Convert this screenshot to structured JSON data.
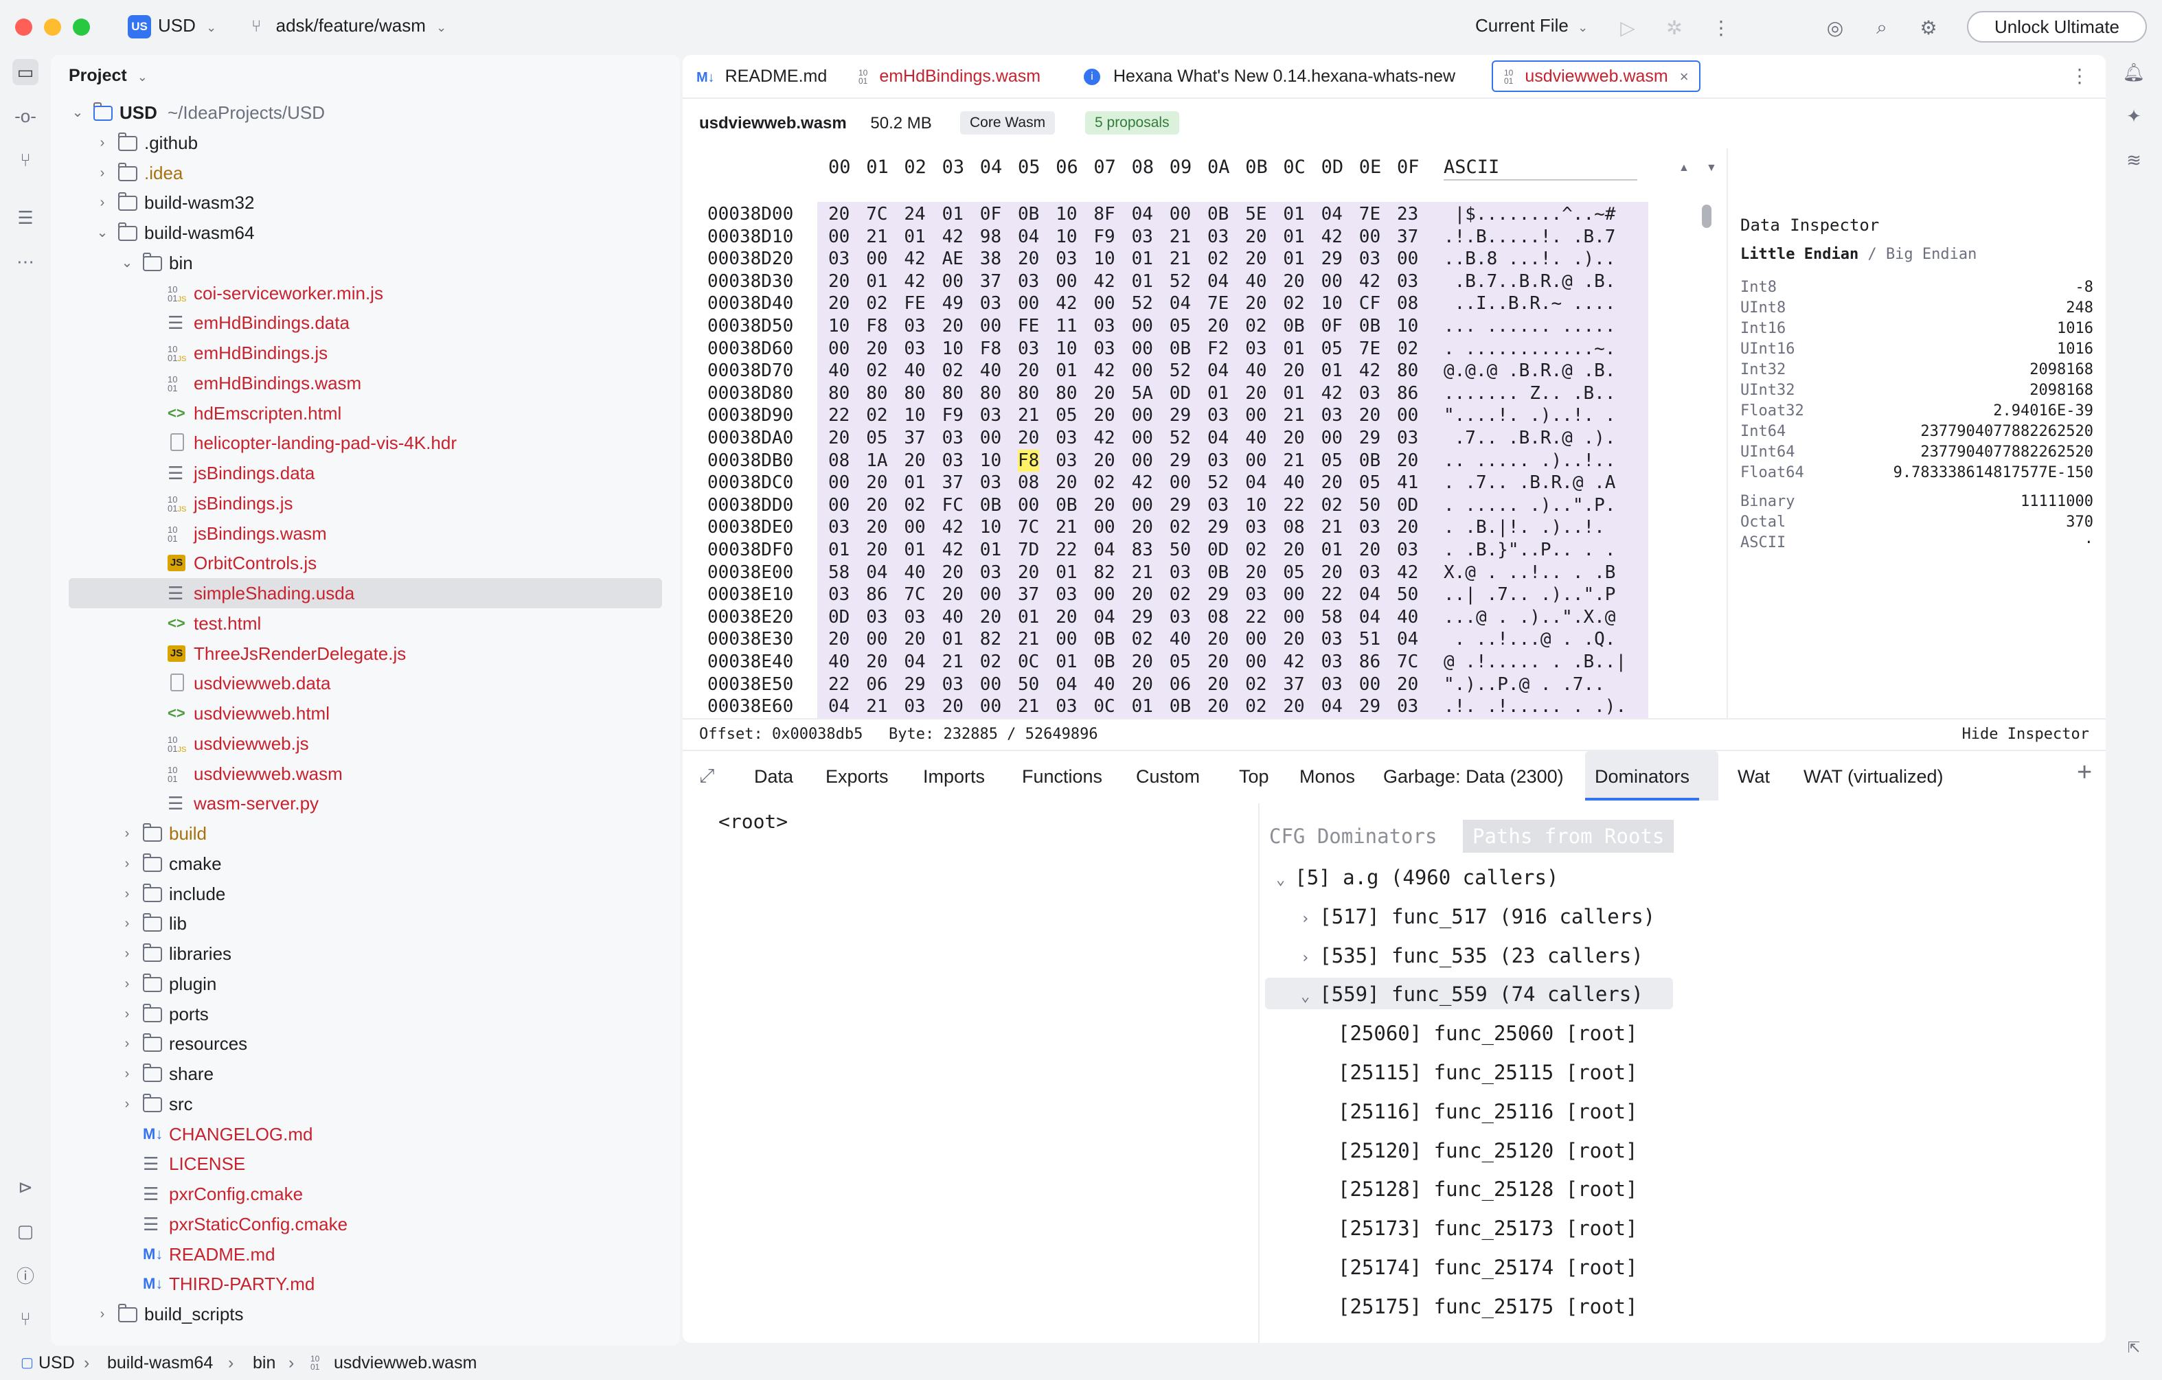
{
  "titlebar": {
    "project_badge": "US",
    "project_name": "USD",
    "branch": "adsk/feature/wasm",
    "run_config": "Current File",
    "unlock_label": "Unlock Ultimate"
  },
  "project_panel": {
    "header": "Project",
    "tree": [
      {
        "label": "USD",
        "suffix": "~/IdeaProjects/USD",
        "depth": 0,
        "chev": "down",
        "icon": "module",
        "color": "dark",
        "bold": true
      },
      {
        "label": ".github",
        "depth": 1,
        "chev": "right",
        "icon": "folder-git",
        "color": "dark"
      },
      {
        "label": ".idea",
        "depth": 1,
        "chev": "right",
        "icon": "folder",
        "color": "brown"
      },
      {
        "label": "build-wasm32",
        "depth": 1,
        "chev": "right",
        "icon": "folder",
        "color": "dark"
      },
      {
        "label": "build-wasm64",
        "depth": 1,
        "chev": "down",
        "icon": "folder",
        "color": "dark"
      },
      {
        "label": "bin",
        "depth": 2,
        "chev": "down",
        "icon": "folder",
        "color": "dark"
      },
      {
        "label": "coi-serviceworker.min.js",
        "depth": 3,
        "icon": "binjs",
        "color": "red"
      },
      {
        "label": "emHdBindings.data",
        "depth": 3,
        "icon": "lines",
        "color": "red"
      },
      {
        "label": "emHdBindings.js",
        "depth": 3,
        "icon": "binjs",
        "color": "red"
      },
      {
        "label": "emHdBindings.wasm",
        "depth": 3,
        "icon": "bin",
        "color": "red"
      },
      {
        "label": "hdEmscripten.html",
        "depth": 3,
        "icon": "html",
        "color": "red"
      },
      {
        "label": "helicopter-landing-pad-vis-4K.hdr",
        "depth": 3,
        "icon": "file",
        "color": "red"
      },
      {
        "label": "jsBindings.data",
        "depth": 3,
        "icon": "lines",
        "color": "red"
      },
      {
        "label": "jsBindings.js",
        "depth": 3,
        "icon": "binjs",
        "color": "red"
      },
      {
        "label": "jsBindings.wasm",
        "depth": 3,
        "icon": "bin",
        "color": "red"
      },
      {
        "label": "OrbitControls.js",
        "depth": 3,
        "icon": "js",
        "color": "red"
      },
      {
        "label": "simpleShading.usda",
        "depth": 3,
        "icon": "lines",
        "color": "red",
        "selected": true
      },
      {
        "label": "test.html",
        "depth": 3,
        "icon": "html",
        "color": "red"
      },
      {
        "label": "ThreeJsRenderDelegate.js",
        "depth": 3,
        "icon": "js",
        "color": "red"
      },
      {
        "label": "usdviewweb.data",
        "depth": 3,
        "icon": "file",
        "color": "red"
      },
      {
        "label": "usdviewweb.html",
        "depth": 3,
        "icon": "html",
        "color": "red"
      },
      {
        "label": "usdviewweb.js",
        "depth": 3,
        "icon": "binjs",
        "color": "red"
      },
      {
        "label": "usdviewweb.wasm",
        "depth": 3,
        "icon": "bin",
        "color": "red"
      },
      {
        "label": "wasm-server.py",
        "depth": 3,
        "icon": "lines",
        "color": "red"
      },
      {
        "label": "build",
        "depth": 2,
        "chev": "right",
        "icon": "folder",
        "color": "brown"
      },
      {
        "label": "cmake",
        "depth": 2,
        "chev": "right",
        "icon": "folder",
        "color": "dark"
      },
      {
        "label": "include",
        "depth": 2,
        "chev": "right",
        "icon": "folder",
        "color": "dark"
      },
      {
        "label": "lib",
        "depth": 2,
        "chev": "right",
        "icon": "folder",
        "color": "dark"
      },
      {
        "label": "libraries",
        "depth": 2,
        "chev": "right",
        "icon": "folder",
        "color": "dark"
      },
      {
        "label": "plugin",
        "depth": 2,
        "chev": "right",
        "icon": "folder",
        "color": "dark"
      },
      {
        "label": "ports",
        "depth": 2,
        "chev": "right",
        "icon": "folder",
        "color": "dark"
      },
      {
        "label": "resources",
        "depth": 2,
        "chev": "right",
        "icon": "folder",
        "color": "dark"
      },
      {
        "label": "share",
        "depth": 2,
        "chev": "right",
        "icon": "folder",
        "color": "dark"
      },
      {
        "label": "src",
        "depth": 2,
        "chev": "right",
        "icon": "folder",
        "color": "dark"
      },
      {
        "label": "CHANGELOG.md",
        "depth": 1.5,
        "icon": "md",
        "color": "red"
      },
      {
        "label": "LICENSE",
        "depth": 1.5,
        "icon": "lines",
        "color": "red"
      },
      {
        "label": "pxrConfig.cmake",
        "depth": 1.5,
        "icon": "lines",
        "color": "red"
      },
      {
        "label": "pxrStaticConfig.cmake",
        "depth": 1.5,
        "icon": "lines",
        "color": "red"
      },
      {
        "label": "README.md",
        "depth": 1.5,
        "icon": "md",
        "color": "red"
      },
      {
        "label": "THIRD-PARTY.md",
        "depth": 1.5,
        "icon": "md",
        "color": "red"
      },
      {
        "label": "build_scripts",
        "depth": 1,
        "chev": "right",
        "icon": "folder",
        "color": "dark"
      }
    ]
  },
  "editor": {
    "tabs": [
      {
        "icon": "M↓",
        "label": "README.md",
        "color": "dark"
      },
      {
        "icon": "10\n01",
        "label": "emHdBindings.wasm",
        "color": "red"
      },
      {
        "icon": "i",
        "label": "Hexana What's New 0.14.hexana-whats-new",
        "color": "dark"
      },
      {
        "icon": "10\n01",
        "label": "usdviewweb.wasm",
        "color": "red",
        "active": true
      }
    ],
    "file_name": "usdviewweb.wasm",
    "file_size": "50.2 MB",
    "badge_format": "Core Wasm",
    "badge_proposals": "5 proposals",
    "hex_header_cols": [
      "00",
      "01",
      "02",
      "03",
      "04",
      "05",
      "06",
      "07",
      "08",
      "09",
      "0A",
      "0B",
      "0C",
      "0D",
      "0E",
      "0F"
    ],
    "ascii_header": "ASCII",
    "hex_rows": [
      {
        "off": "00038D00",
        "bytes": "20 7C 24 01 0F 0B 10 8F 04 00 0B 5E 01 04 7E 23",
        "ascii": " |$........^..~#"
      },
      {
        "off": "00038D10",
        "bytes": "00 21 01 42 98 04 10 F9 03 21 03 20 01 42 00 37",
        "ascii": ".!.B.....!. .B.7"
      },
      {
        "off": "00038D20",
        "bytes": "03 00 42 AE 38 20 03 10 01 21 02 20 01 29 03 00",
        "ascii": "..B.8 ...!. .).."
      },
      {
        "off": "00038D30",
        "bytes": "20 01 42 00 37 03 00 42 01 52 04 40 20 00 42 03",
        "ascii": " .B.7..B.R.@ .B."
      },
      {
        "off": "00038D40",
        "bytes": "20 02 FE 49 03 00 42 00 52 04 7E 20 02 10 CF 08",
        "ascii": " ..I..B.R.~ ...."
      },
      {
        "off": "00038D50",
        "bytes": "10 F8 03 20 00 FE 11 03 00 05 20 02 0B 0F 0B 10",
        "ascii": "... ...... ....."
      },
      {
        "off": "00038D60",
        "bytes": "00 20 03 10 F8 03 10 03 00 0B F2 03 01 05 7E 02",
        "ascii": ". ............~."
      },
      {
        "off": "00038D70",
        "bytes": "40 02 40 02 40 20 01 42 00 52 04 40 20 01 42 80",
        "ascii": "@.@.@ .B.R.@ .B."
      },
      {
        "off": "00038D80",
        "bytes": "80 80 80 80 80 80 80 20 5A 0D 01 20 01 42 03 86",
        "ascii": "....... Z.. .B.."
      },
      {
        "off": "00038D90",
        "bytes": "22 02 10 F9 03 21 05 20 00 29 03 00 21 03 20 00",
        "ascii": "\"....!. .)..!. ."
      },
      {
        "off": "00038DA0",
        "bytes": "20 05 37 03 00 20 03 42 00 52 04 40 20 00 29 03",
        "ascii": " .7.. .B.R.@ .)."
      },
      {
        "off": "00038DB0",
        "bytes": "08 1A 20 03 10 F8 03 20 00 29 03 00 21 05 0B 20",
        "ascii": ".. ..... .)..!.. "
      },
      {
        "off": "00038DC0",
        "bytes": "00 20 01 37 03 08 20 02 42 00 52 04 40 20 05 41",
        "ascii": ". .7.. .B.R.@ .A"
      },
      {
        "off": "00038DD0",
        "bytes": "00 20 02 FC 0B 00 0B 20 00 29 03 10 22 02 50 0D",
        "ascii": ". ..... .)..\".P."
      },
      {
        "off": "00038DE0",
        "bytes": "03 20 00 42 10 7C 21 00 20 02 29 03 08 21 03 20",
        "ascii": ". .B.|!. .)..!. "
      },
      {
        "off": "00038DF0",
        "bytes": "01 20 01 42 01 7D 22 04 83 50 0D 02 20 01 20 03",
        "ascii": ". .B.}\"..P.. . ."
      },
      {
        "off": "00038E00",
        "bytes": "58 04 40 20 03 20 01 82 21 03 0B 20 05 20 03 42",
        "ascii": "X.@ . ..!.. . .B"
      },
      {
        "off": "00038E10",
        "bytes": "03 86 7C 20 00 37 03 00 20 02 29 03 00 22 04 50",
        "ascii": "..| .7.. .)..\".P"
      },
      {
        "off": "00038E20",
        "bytes": "0D 03 03 40 20 01 20 04 29 03 08 22 00 58 04 40",
        "ascii": "...@ . .)..\".X.@"
      },
      {
        "off": "00038E30",
        "bytes": "20 00 20 01 82 21 00 0B 02 40 20 00 20 03 51 04",
        "ascii": " . ..!...@ . .Q."
      },
      {
        "off": "00038E40",
        "bytes": "40 20 04 21 02 0C 01 0B 20 05 20 00 42 03 86 7C",
        "ascii": "@ .!..... . .B..|"
      },
      {
        "off": "00038E50",
        "bytes": "22 06 29 03 00 50 04 40 20 06 20 02 37 03 00 20",
        "ascii": "\".)..P.@ . .7.. "
      },
      {
        "off": "00038E60",
        "bytes": "04 21 03 20 00 21 03 0C 01 0B 20 02 20 04 29 03",
        "ascii": ".!. .!..... . .)."
      }
    ],
    "highlight": {
      "row": 11,
      "col": 5
    },
    "inspector": {
      "title": "Data Inspector",
      "endian_active": "Little Endian",
      "endian_sep": "/",
      "endian_other": "Big Endian",
      "rows": [
        {
          "k": "Int8",
          "v": "-8"
        },
        {
          "k": "UInt8",
          "v": "248"
        },
        {
          "k": "Int16",
          "v": "1016"
        },
        {
          "k": "UInt16",
          "v": "1016"
        },
        {
          "k": "Int32",
          "v": "2098168"
        },
        {
          "k": "UInt32",
          "v": "2098168"
        },
        {
          "k": "Float32",
          "v": "2.94016E-39"
        },
        {
          "k": "Int64",
          "v": "2377904077882262520"
        },
        {
          "k": "UInt64",
          "v": "2377904077882262520"
        },
        {
          "k": "Float64",
          "v": "9.783338614817577E-150"
        }
      ],
      "rows2": [
        {
          "k": "Binary",
          "v": "11111000"
        },
        {
          "k": "Octal",
          "v": "370"
        },
        {
          "k": "ASCII",
          "v": "·"
        }
      ]
    },
    "status_offset": "Offset: 0x00038db5",
    "status_byte": "Byte: 232885 / 52649896",
    "hide_inspector": "Hide Inspector"
  },
  "bottom": {
    "tabs": [
      "Data",
      "Exports",
      "Imports",
      "Functions",
      "Custom",
      "Top",
      "Monos",
      "Garbage: Data (2300)",
      "Dominators",
      "Wat",
      "WAT (virtualized)"
    ],
    "active_tab": "Dominators",
    "root_label": "<root>",
    "cfg_tab": "CFG Dominators",
    "paths_tab": "Paths from Roots",
    "dom_rows": [
      {
        "text": "[5] a.g (4960 callers)",
        "indent": 0,
        "chev": "down"
      },
      {
        "text": "[517] func_517 (916 callers)",
        "indent": 1,
        "chev": "right"
      },
      {
        "text": "[535] func_535 (23 callers)",
        "indent": 1,
        "chev": "right"
      },
      {
        "text": "[559] func_559 (74 callers)",
        "indent": 1,
        "chev": "down",
        "selected": true
      },
      {
        "text": "[25060] func_25060 [root]",
        "indent": 2
      },
      {
        "text": "[25115] func_25115 [root]",
        "indent": 2
      },
      {
        "text": "[25116] func_25116 [root]",
        "indent": 2
      },
      {
        "text": "[25120] func_25120 [root]",
        "indent": 2
      },
      {
        "text": "[25128] func_25128 [root]",
        "indent": 2
      },
      {
        "text": "[25173] func_25173 [root]",
        "indent": 2
      },
      {
        "text": "[25174] func_25174 [root]",
        "indent": 2
      },
      {
        "text": "[25175] func_25175 [root]",
        "indent": 2
      }
    ]
  },
  "breadcrumb": [
    "USD",
    "build-wasm64",
    "bin",
    "usdviewweb.wasm"
  ]
}
